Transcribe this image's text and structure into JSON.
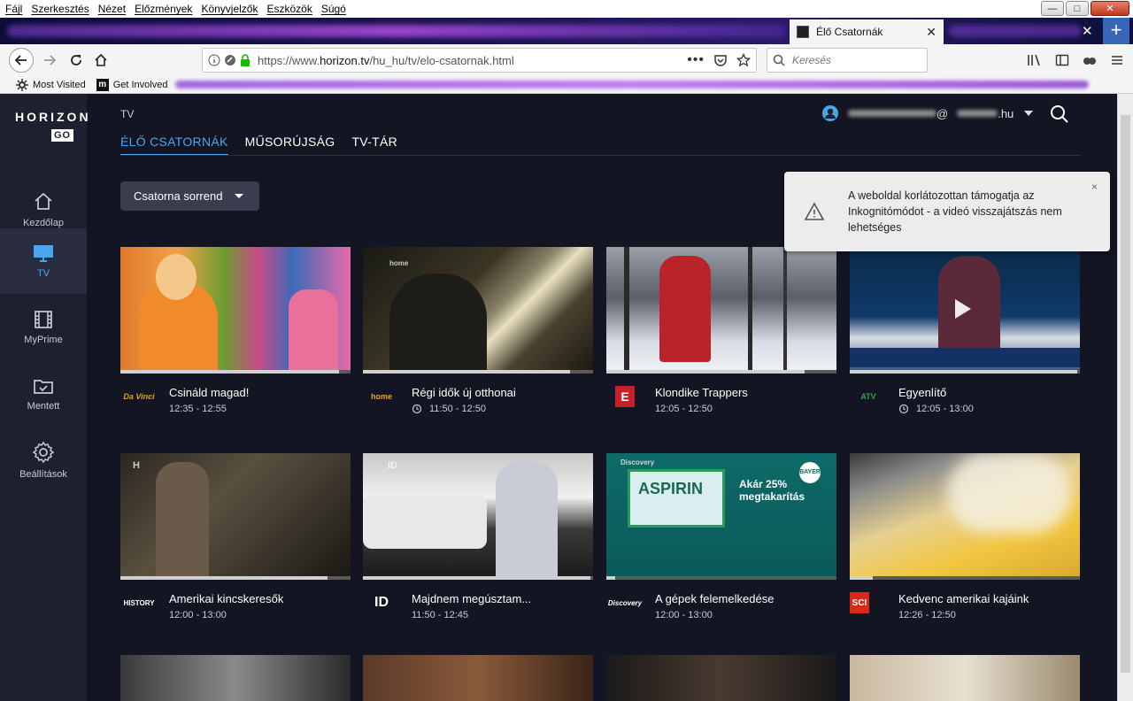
{
  "menu": [
    "Fájl",
    "Szerkesztés",
    "Nézet",
    "Előzmények",
    "Könyvjelzők",
    "Eszközök",
    "Súgó"
  ],
  "tab": {
    "title": "Élő Csatornák"
  },
  "url": {
    "prefix": "https://www.",
    "domain": "horizon.tv",
    "path": "/hu_hu/tv/elo-csatornak.html"
  },
  "search": {
    "placeholder": "Keresés"
  },
  "bookmarks": {
    "most_visited": "Most Visited",
    "get_involved": "Get Involved"
  },
  "app": {
    "logo_main": "HORIZON",
    "logo_go": "GO",
    "sidebar": [
      {
        "label": "Kezdőlap",
        "icon": "home-icon"
      },
      {
        "label": "TV",
        "icon": "tv-icon",
        "active": true
      },
      {
        "label": "MyPrime",
        "icon": "film-icon"
      },
      {
        "label": "Mentett",
        "icon": "folder-icon"
      },
      {
        "label": "Beállítások",
        "icon": "gear-icon"
      }
    ],
    "breadcrumb": "TV",
    "tabs": [
      "ÉLŐ CSATORNÁK",
      "MŰSORÚJSÁG",
      "TV-TÁR"
    ],
    "user_suffix": ".hu",
    "sort_label": "Csatorna sorrend",
    "toast": "A weboldal korlátozottan támogatja az Inkognitómódot - a videó visszajátszás nem lehetséges",
    "toast_close": "×"
  },
  "cards": [
    {
      "title": "Csináld magad!",
      "time": "12:35 - 12:55",
      "channel": "Da Vinci",
      "progress": 0.95,
      "replay": false
    },
    {
      "title": "Régi idők új otthonai",
      "time": "11:50 - 12:50",
      "channel": "home",
      "progress": 0.9,
      "replay": true
    },
    {
      "title": "Klondike Trappers",
      "time": "12:05 - 12:50",
      "channel": "E",
      "progress": 0.86,
      "replay": false
    },
    {
      "title": "Egyenlítő",
      "time": "12:05 - 13:00",
      "channel": "ATV",
      "progress": 0.99,
      "replay": true
    },
    {
      "title": "Amerikai kincskeresők",
      "time": "12:00 - 13:00",
      "channel": "HISTORY",
      "progress": 0.9,
      "replay": false
    },
    {
      "title": "Majdnem megúsztam...",
      "time": "11:50 - 12:45",
      "channel": "ID",
      "progress": 0.99,
      "replay": false
    },
    {
      "title": "A gépek felemelkedése",
      "time": "12:00 - 13:00",
      "channel": "Discovery",
      "progress": 0.04,
      "replay": false
    },
    {
      "title": "Kedvenc amerikai kajáink",
      "time": "12:26 - 12:50",
      "channel": "SCI",
      "progress": 0.1,
      "replay": false
    }
  ],
  "colors": {
    "accent": "#4aa5ee",
    "bg": "#141522",
    "sidebar": "#1e2030"
  }
}
